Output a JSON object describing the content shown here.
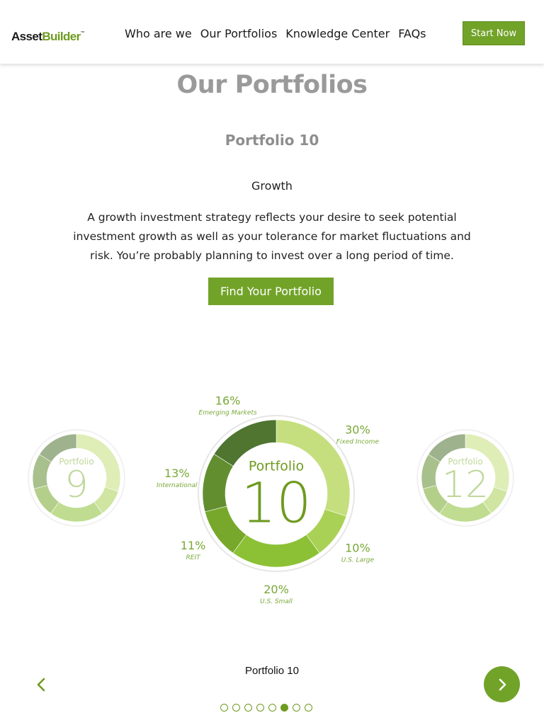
{
  "header": {
    "logo_part1": "Asset",
    "logo_part2": "Builder",
    "logo_mark": "™",
    "nav": [
      "Who are we",
      "Our Portfolios",
      "Knowledge Center",
      "FAQs"
    ],
    "cta": "Start Now"
  },
  "main": {
    "title": "Our Portfolios",
    "portfolio_heading": "Portfolio 10",
    "strategy": "Growth",
    "description": "A growth investment strategy reflects your desire to seek potential investment growth as well as your tolerance for market fluctuations and risk. You’re probably planning to invest over a long period of time.",
    "find_button": "Find Your Portfolio"
  },
  "carousel": {
    "caption": "Portfolio 10",
    "prev_icon": "chevron-left-icon",
    "next_icon": "chevron-right-icon",
    "dot_count": 8,
    "active_dot": 5,
    "side_left": {
      "label": "Portfolio",
      "number": "9"
    },
    "side_right": {
      "label": "Portfolio",
      "number": "12"
    }
  },
  "colors": {
    "accent": "#72a329",
    "title_gray": "#9a9a9a"
  },
  "chart_data": {
    "type": "pie",
    "center_label": "Portfolio",
    "center_number": "10",
    "slices": [
      {
        "name": "Fixed Income",
        "value": 30,
        "display": "30%",
        "color": "#c5df7e"
      },
      {
        "name": "U.S. Large",
        "value": 10,
        "display": "10%",
        "color": "#a9d156"
      },
      {
        "name": "U.S. Small",
        "value": 20,
        "display": "20%",
        "color": "#8cc136"
      },
      {
        "name": "REIT",
        "value": 11,
        "display": "11%",
        "color": "#77a82b"
      },
      {
        "name": "International",
        "value": 13,
        "display": "13%",
        "color": "#628e2f"
      },
      {
        "name": "Emerging Markets",
        "value": 16,
        "display": "16%",
        "color": "#4f7531"
      }
    ]
  }
}
